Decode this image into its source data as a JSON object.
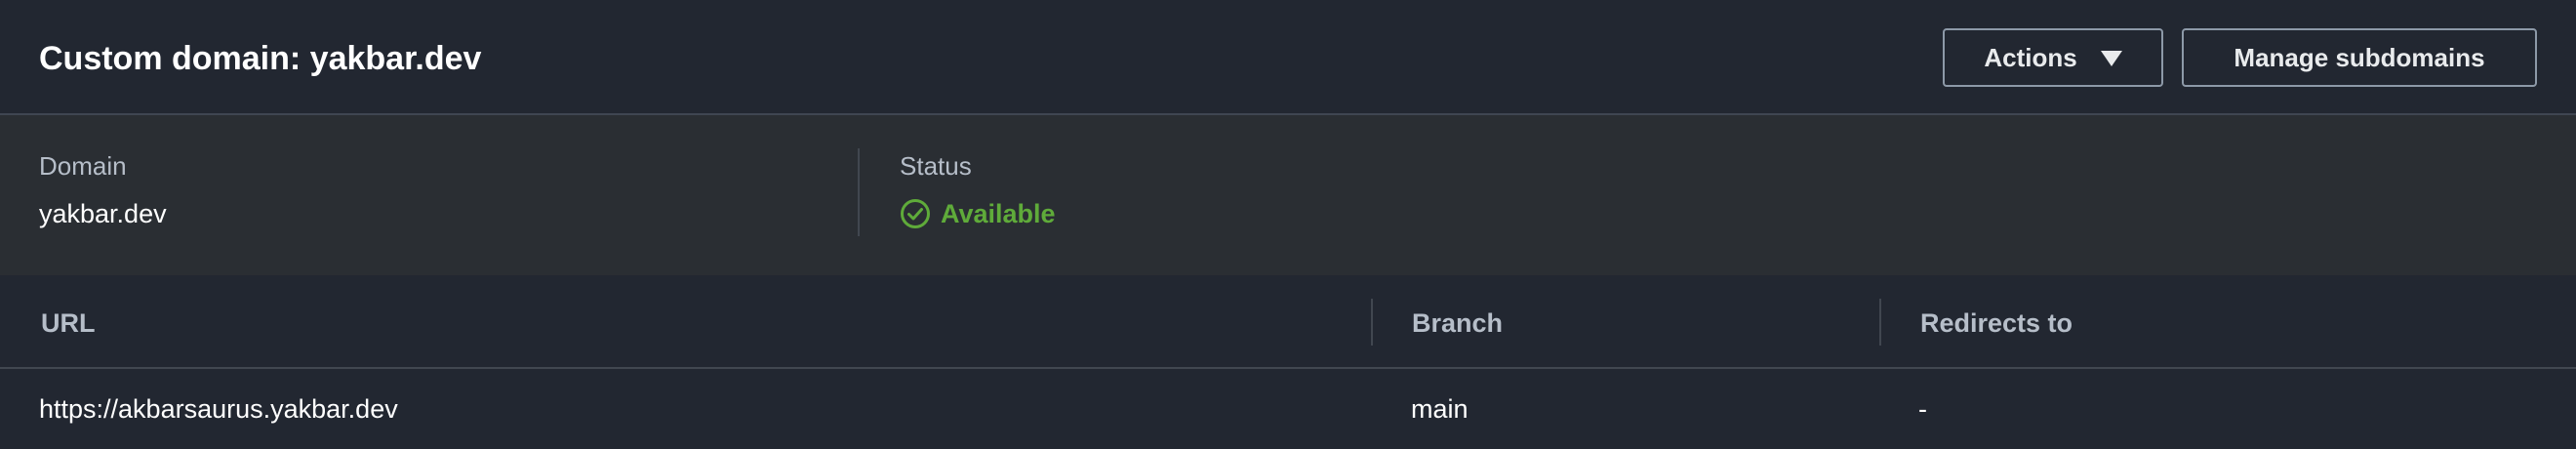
{
  "header": {
    "title": "Custom domain: yakbar.dev",
    "actions_label": "Actions",
    "manage_label": "Manage subdomains"
  },
  "details": {
    "domain_label": "Domain",
    "domain_value": "yakbar.dev",
    "status_label": "Status",
    "status_value": "Available",
    "status_icon": "check-circle-icon"
  },
  "table": {
    "columns": [
      "URL",
      "Branch",
      "Redirects to"
    ],
    "rows": [
      [
        "https://akbarsaurus.yakbar.dev",
        "main",
        "-"
      ]
    ]
  },
  "colors": {
    "background": "#222731",
    "details_background": "#2a2e33",
    "status_success": "#5fab3a",
    "border": "#414750"
  }
}
